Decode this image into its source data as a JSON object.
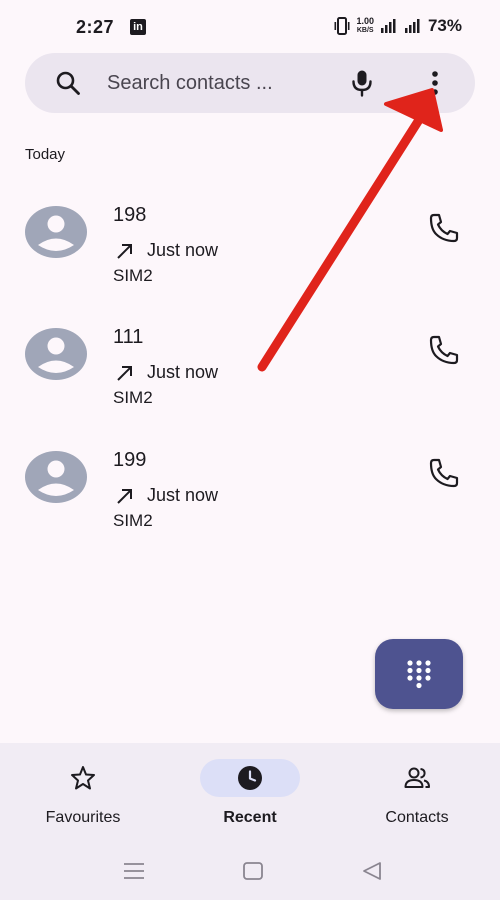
{
  "status_bar": {
    "time": "2:27",
    "app_badge": "in",
    "net_speed_value": "1.00",
    "net_speed_unit": "KB/S",
    "battery": "73%"
  },
  "search": {
    "placeholder": "Search contacts ..."
  },
  "section": {
    "label": "Today"
  },
  "calls": [
    {
      "number": "198",
      "time": "Just now",
      "sim": "SIM2"
    },
    {
      "number": "111",
      "time": "Just now",
      "sim": "SIM2"
    },
    {
      "number": "199",
      "time": "Just now",
      "sim": "SIM2"
    }
  ],
  "nav": {
    "items": [
      {
        "label": "Favourites",
        "icon": "star-icon"
      },
      {
        "label": "Recent",
        "icon": "clock-icon",
        "active": true
      },
      {
        "label": "Contacts",
        "icon": "people-icon"
      }
    ]
  },
  "colors": {
    "background": "#fdf7fb",
    "search_bg": "#ebe5ef",
    "fab": "#4e5390",
    "nav_bg": "#f1ecf4",
    "nav_active_pill": "#dcdff7",
    "avatar": "#a0a6b8",
    "annotation": "#e0241b"
  }
}
